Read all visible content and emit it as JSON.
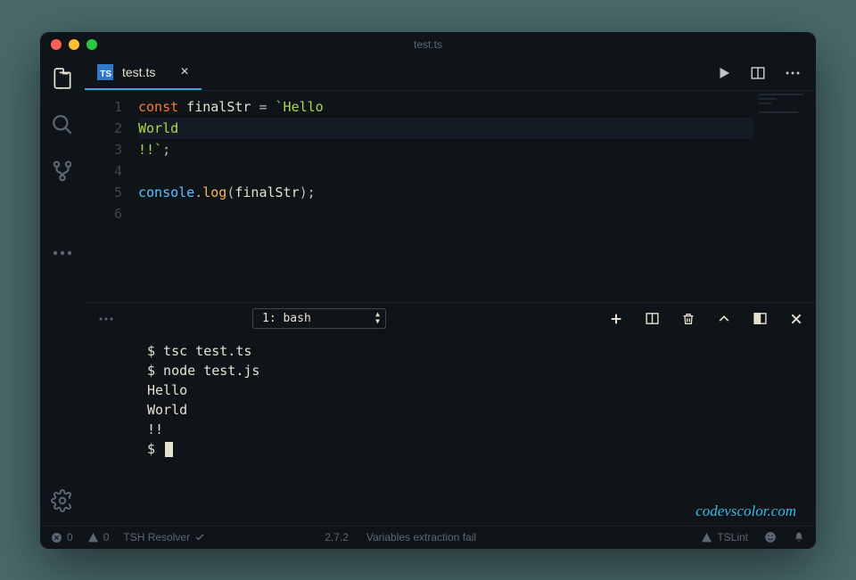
{
  "window": {
    "title": "test.ts"
  },
  "tab": {
    "label": "test.ts",
    "icon": "TS"
  },
  "code": {
    "lines": [
      {
        "n": "1",
        "seg": [
          [
            "kw",
            "const"
          ],
          [
            "",
            ""
          ],
          [
            "var",
            " finalStr "
          ],
          [
            "punc",
            "= "
          ],
          [
            "str",
            "`Hello"
          ]
        ]
      },
      {
        "n": "2",
        "hl": true,
        "seg": [
          [
            "str",
            "World"
          ]
        ]
      },
      {
        "n": "3",
        "seg": [
          [
            "str",
            "!!`"
          ],
          [
            "punc",
            ";"
          ]
        ]
      },
      {
        "n": "4",
        "seg": []
      },
      {
        "n": "5",
        "seg": [
          [
            "obj",
            "console"
          ],
          [
            "punc",
            "."
          ],
          [
            "fn",
            "log"
          ],
          [
            "punc",
            "("
          ],
          [
            "var",
            "finalStr"
          ],
          [
            "punc",
            ");"
          ]
        ]
      },
      {
        "n": "6",
        "seg": []
      }
    ]
  },
  "terminalSelect": "1: bash",
  "terminal": [
    "$ tsc test.ts",
    "$ node test.js",
    "Hello",
    "World",
    "!!",
    "$ "
  ],
  "watermark": "codevscolor.com",
  "status": {
    "errors": "0",
    "warnings": "0",
    "resolver": "TSH Resolver",
    "version": "2.7.2",
    "extraction": "Variables extraction fail",
    "tslint": "TSLint"
  }
}
